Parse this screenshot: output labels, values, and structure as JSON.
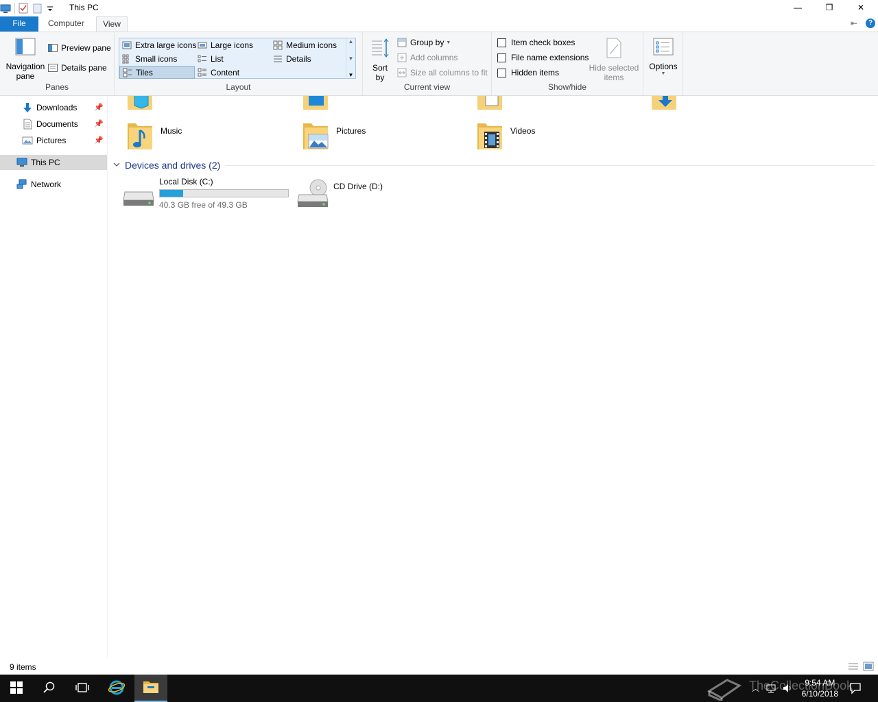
{
  "window": {
    "title": "This PC",
    "minimize_glyph": "—",
    "restore_glyph": "❐",
    "close_glyph": "✕"
  },
  "ribbon_tabs": {
    "file": "File",
    "computer": "Computer",
    "view": "View",
    "pin_glyph": "⇤",
    "help_glyph": "?"
  },
  "panes": {
    "navigation_pane": "Navigation",
    "navigation_pane_2": "pane",
    "preview_pane": "Preview pane",
    "details_pane": "Details pane",
    "label": "Panes"
  },
  "layout": {
    "items": [
      "Extra large icons",
      "Large icons",
      "Medium icons",
      "Small icons",
      "List",
      "Details",
      "Tiles",
      "Content"
    ],
    "selected": "Tiles",
    "label": "Layout"
  },
  "current_view": {
    "sort_by_1": "Sort",
    "sort_by_2": "by",
    "group_by": "Group by",
    "add_columns": "Add columns",
    "size_columns": "Size all columns to fit",
    "label": "Current view"
  },
  "show_hide": {
    "item_check_boxes": "Item check boxes",
    "file_name_extensions": "File name extensions",
    "hidden_items": "Hidden items",
    "hide_selected_1": "Hide selected",
    "hide_selected_2": "items",
    "label": "Show/hide"
  },
  "options": {
    "label": "Options"
  },
  "nav": {
    "downloads": "Downloads",
    "documents": "Documents",
    "pictures": "Pictures",
    "this_pc": "This PC",
    "network": "Network"
  },
  "folders": {
    "music": "Music",
    "pictures": "Pictures",
    "videos": "Videos"
  },
  "devices": {
    "section_title": "Devices and drives (2)",
    "local_disk": "Local Disk (C:)",
    "local_disk_free": "40.3 GB free of 49.3 GB",
    "local_disk_used_fraction": 0.18,
    "cd_drive": "CD Drive (D:)"
  },
  "status": {
    "item_count": "9 items"
  },
  "taskbar": {
    "time": "9:54 AM",
    "date": "6/10/2018",
    "watermark": "TheCollectionBook"
  },
  "colors": {
    "accent": "#1979ca",
    "section_title": "#1e3287",
    "progress": "#26a0da"
  }
}
